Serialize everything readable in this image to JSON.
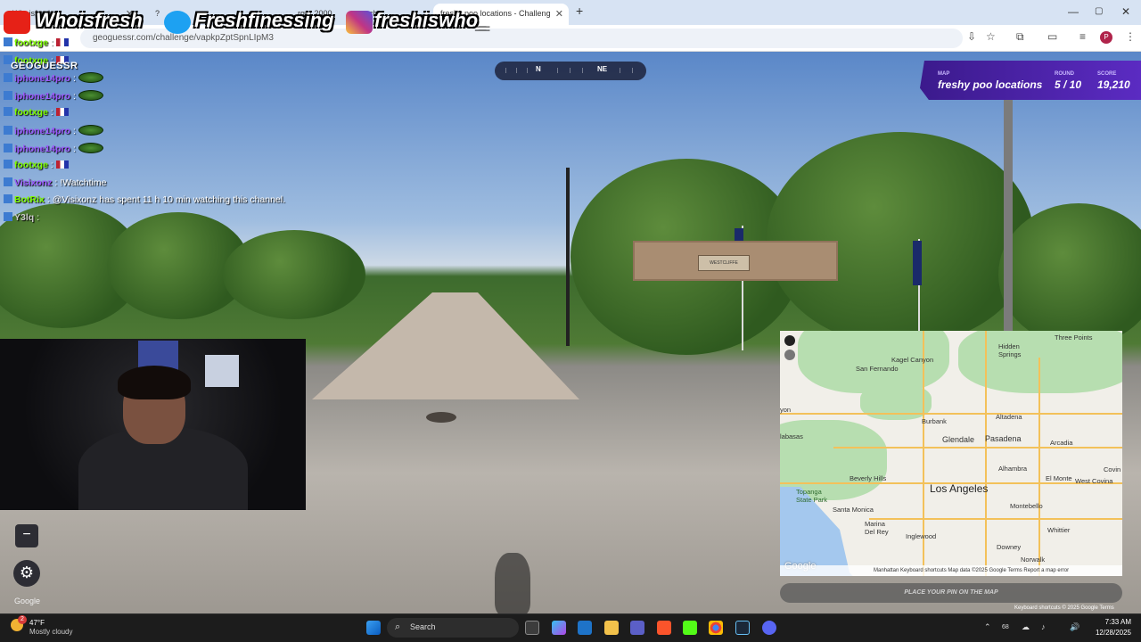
{
  "browser": {
    "tabs": [
      {
        "label": "Whoisfresh",
        "active": false
      },
      {
        "label": "?",
        "active": false
      },
      {
        "label": "rger 2000",
        "active": false
      },
      {
        "label": "ch",
        "active": false
      },
      {
        "label": "freshy poo locations - Challeng",
        "active": true
      }
    ],
    "new_tab": "+",
    "url": "geoguessr.com/challenge/vapkpZptSpnLIpM3",
    "window_controls": {
      "minimize": "—",
      "maximize": "▢",
      "close": "✕"
    }
  },
  "overlay": {
    "socials": [
      {
        "platform": "youtube",
        "handle": "Whoisfresh",
        "color": "#e62117"
      },
      {
        "platform": "twitter",
        "handle": "Freshfinessing",
        "color": "#1da1f2"
      },
      {
        "platform": "instagram",
        "handle": "freshiswho_",
        "color": "#c13584"
      }
    ],
    "chat": [
      {
        "user": "footxge",
        "color": "#7fff00",
        "sep": ":",
        "msg": "",
        "emote": "flag"
      },
      {
        "user": "footxge",
        "color": "#7fff00",
        "sep": ":",
        "msg": "",
        "emote": "flag"
      },
      {
        "user": "iphone14pro",
        "color": "#9b59ff",
        "sep": ":",
        "msg": "",
        "emote": "melon"
      },
      {
        "user": "iphone14pro",
        "color": "#9b59ff",
        "sep": ":",
        "msg": "",
        "emote": "melon"
      },
      {
        "user": "footxge",
        "color": "#7fff00",
        "sep": ":",
        "msg": "",
        "emote": "flag"
      },
      {
        "user": "iphone14pro",
        "color": "#9b59ff",
        "sep": ":",
        "msg": "",
        "emote": "melon"
      },
      {
        "user": "iphone14pro",
        "color": "#9b59ff",
        "sep": ":",
        "msg": "",
        "emote": "melon"
      },
      {
        "user": "footxge",
        "color": "#7fff00",
        "sep": ":",
        "msg": "",
        "emote": "flag"
      },
      {
        "user": "Visixonz",
        "color": "#9b59ff",
        "sep": ":",
        "msg": "!Watchtime",
        "emote": ""
      },
      {
        "user": "BotRix",
        "color": "#7fff00",
        "sep": ":",
        "msg": "@Visixonz has spent 11 h 10 min watching this channel.",
        "emote": ""
      },
      {
        "user": "Y3lq",
        "color": "#cccccc",
        "sep": ":",
        "msg": "",
        "emote": ""
      }
    ]
  },
  "game": {
    "logo": "GEOGUESSR",
    "compass": {
      "n": "N",
      "ne": "NE"
    },
    "status": {
      "map_label": "MAP",
      "map_value": "freshy poo locations",
      "round_label": "ROUND",
      "round_value": "5 / 10",
      "score_label": "SCORE",
      "score_value": "19,210"
    },
    "sign_text": "WESTCLIFFE",
    "place_pin": "PLACE YOUR PIN ON THE MAP",
    "zoom_out": "−",
    "settings_icon": "⚙",
    "google": "Google",
    "sv_footer": "Keyboard shortcuts   © 2025 Google   Terms"
  },
  "minimap": {
    "labels": [
      {
        "text": "Three Points"
      },
      {
        "text": "Kagel Canyon"
      },
      {
        "text": "Hidden Springs"
      },
      {
        "text": "San Fernando"
      },
      {
        "text": "Altadena"
      },
      {
        "text": "Burbank"
      },
      {
        "text": "Glendale"
      },
      {
        "text": "Pasadena"
      },
      {
        "text": "Arcadia"
      },
      {
        "text": "labasas"
      },
      {
        "text": "Topanga State Park"
      },
      {
        "text": "Alhambra"
      },
      {
        "text": "Covin"
      },
      {
        "text": "Beverly Hills"
      },
      {
        "text": "El Monte"
      },
      {
        "text": "West Covina"
      },
      {
        "text": "Los Angeles"
      },
      {
        "text": "Santa Monica"
      },
      {
        "text": "Montebello"
      },
      {
        "text": "Marina Del Rey"
      },
      {
        "text": "Whittier"
      },
      {
        "text": "Inglewood"
      },
      {
        "text": "Downey"
      },
      {
        "text": "Norwalk"
      },
      {
        "text": "yon"
      }
    ],
    "google": "Google",
    "footer": "Manhattan   Keyboard shortcuts   Map data ©2025 Google   Terms   Report a map error"
  },
  "taskbar": {
    "weather_temp": "47°F",
    "weather_desc": "Mostly cloudy",
    "weather_badge": "2",
    "search_label": "Search",
    "time": "7:33 AM",
    "date": "12/28/2025",
    "tray": [
      "⌃",
      "68",
      "☁",
      "♪",
      "🔊"
    ]
  }
}
